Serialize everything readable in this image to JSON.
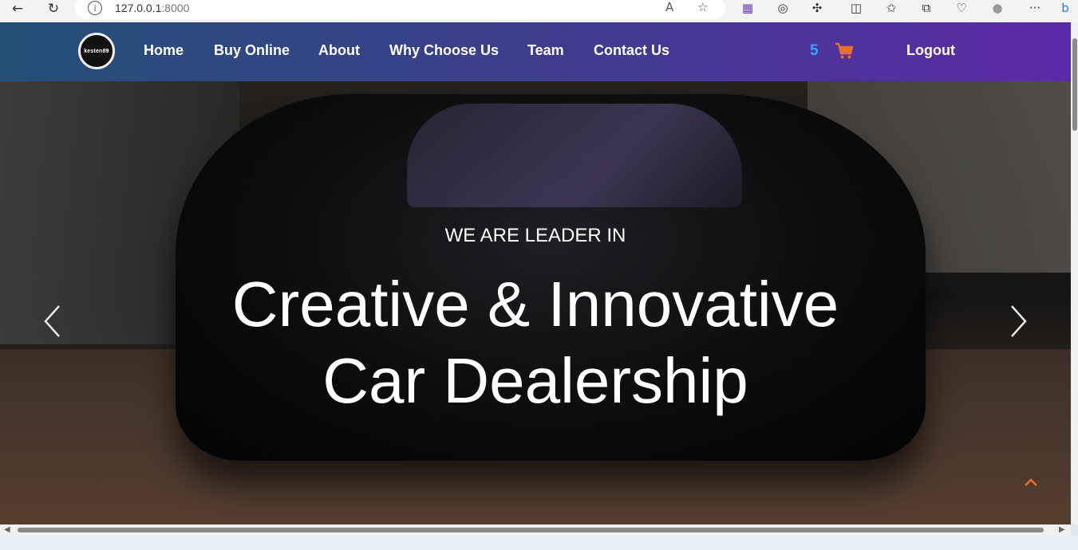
{
  "browser": {
    "url_host": "127.0.0.1",
    "url_port": ":8000"
  },
  "nav": {
    "logo_text": "kesten89",
    "items": [
      "Home",
      "Buy Online",
      "About",
      "Why Choose Us",
      "Team",
      "Contact Us"
    ],
    "cart_count": "5",
    "logout": "Logout"
  },
  "hero": {
    "subtitle": "WE ARE LEADER IN",
    "title_line1": "Creative & Innovative",
    "title_line2": "Car Dealership"
  },
  "colors": {
    "nav_start": "#245077",
    "nav_end": "#5d2aa8",
    "cart_count": "#2fa8ff",
    "accent_orange": "#e8722c"
  }
}
